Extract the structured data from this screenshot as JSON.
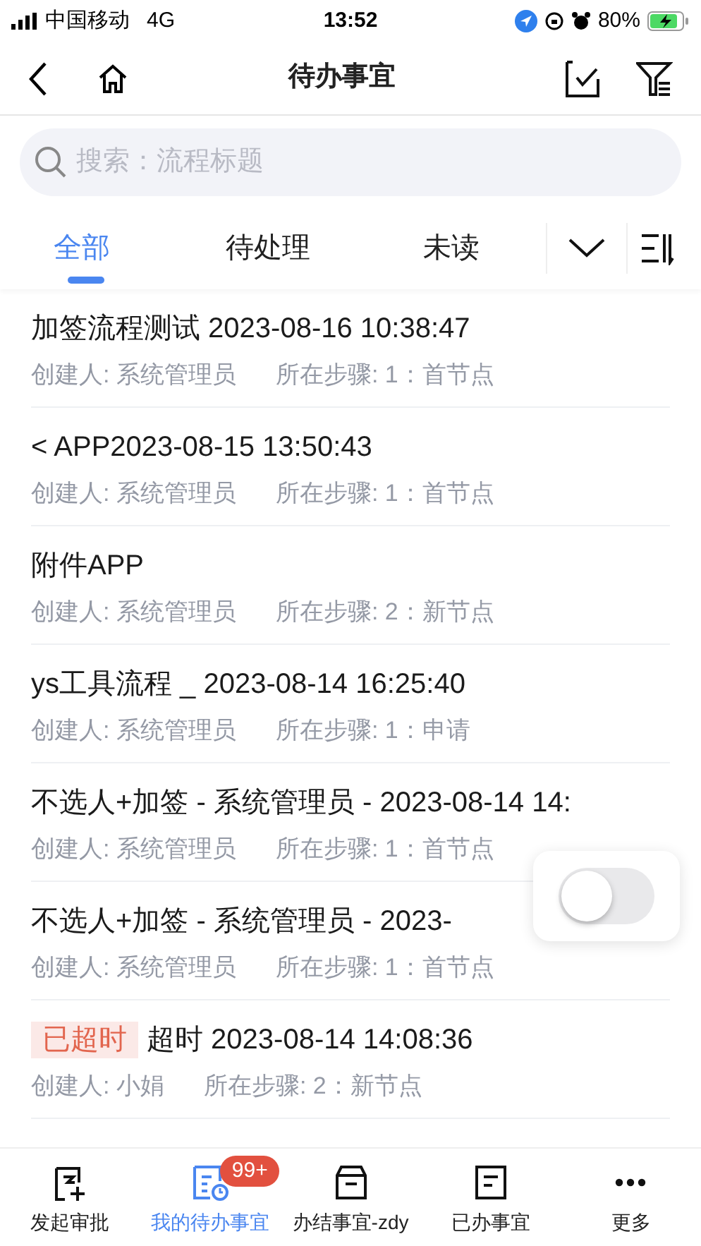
{
  "status_bar": {
    "carrier": "中国移动",
    "network": "4G",
    "time": "13:52",
    "battery": "80%"
  },
  "nav": {
    "title": "待办事宜"
  },
  "search": {
    "placeholder": "搜索：流程标题"
  },
  "tabs": [
    {
      "label": "全部",
      "selected": true
    },
    {
      "label": "待处理",
      "selected": false
    },
    {
      "label": "未读",
      "selected": false
    }
  ],
  "items": [
    {
      "title": "加签流程测试  2023-08-16 10:38:47",
      "creator": "创建人: 系统管理员",
      "step": "所在步骤: 1：首节点",
      "overdue": false
    },
    {
      "title": "< APP2023-08-15 13:50:43",
      "creator": "创建人: 系统管理员",
      "step": "所在步骤: 1：首节点",
      "overdue": false
    },
    {
      "title": "附件APP",
      "creator": "创建人: 系统管理员",
      "step": "所在步骤: 2：新节点",
      "overdue": false
    },
    {
      "title": "ys工具流程 _ 2023-08-14 16:25:40",
      "creator": "创建人: 系统管理员",
      "step": "所在步骤: 1：申请",
      "overdue": false
    },
    {
      "title": "不选人+加签  -  系统管理员  -  2023-08-14 14:",
      "creator": "创建人: 系统管理员",
      "step": "所在步骤: 1：首节点",
      "overdue": false
    },
    {
      "title": "不选人+加签  -  系统管理员  -  2023-",
      "creator": "创建人: 系统管理员",
      "step": "所在步骤: 1：首节点",
      "overdue": false
    },
    {
      "title": "超时 2023-08-14 14:08:36",
      "badge": "已超时",
      "creator": "创建人: 小娟",
      "step": "所在步骤: 2：新节点",
      "overdue": true
    }
  ],
  "floating_toggle": {
    "on": false
  },
  "bottom_tabs": [
    {
      "label": "发起审批",
      "selected": false
    },
    {
      "label": "我的待办事宜",
      "badge": "99+",
      "selected": true
    },
    {
      "label": "办结事宜-zdy",
      "selected": false
    },
    {
      "label": "已办事宜",
      "selected": false
    },
    {
      "label": "更多",
      "selected": false
    }
  ]
}
